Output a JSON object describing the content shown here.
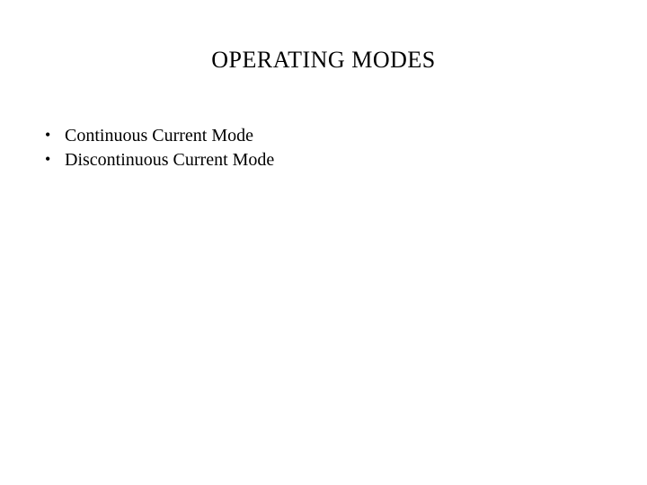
{
  "title": "OPERATING MODES",
  "bullets": [
    "Continuous Current Mode",
    "Discontinuous Current Mode"
  ]
}
